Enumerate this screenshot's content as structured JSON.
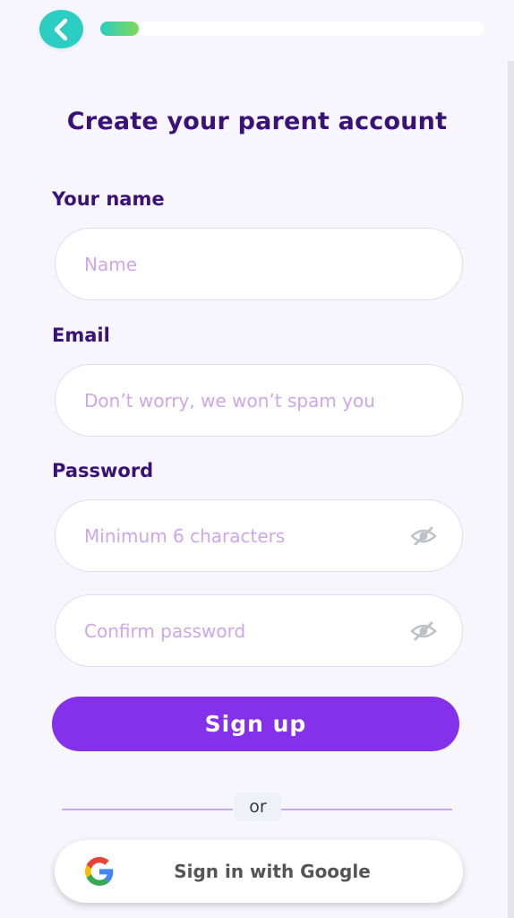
{
  "header": {
    "back_icon": "chevron-left-icon",
    "progress_fraction": 0.1
  },
  "form": {
    "title": "Create your parent account",
    "name": {
      "label": "Your name",
      "placeholder": "Name",
      "value": ""
    },
    "email": {
      "label": "Email",
      "placeholder": "Don’t worry, we won’t spam you",
      "value": ""
    },
    "password": {
      "label": "Password",
      "placeholder": "Minimum 6 characters",
      "value": "",
      "toggle_icon": "eye-hidden-icon"
    },
    "confirm_password": {
      "placeholder": "Confirm password",
      "value": "",
      "toggle_icon": "eye-hidden-icon"
    },
    "signup_label": "Sign up",
    "divider_text": "or",
    "google_label": "Sign in with Google",
    "google_icon": "google-logo-icon"
  },
  "colors": {
    "accent_teal": "#2ccdc2",
    "primary_purple": "#8530ea",
    "heading_purple": "#3a1177",
    "placeholder_lilac": "#cfa6e7"
  }
}
